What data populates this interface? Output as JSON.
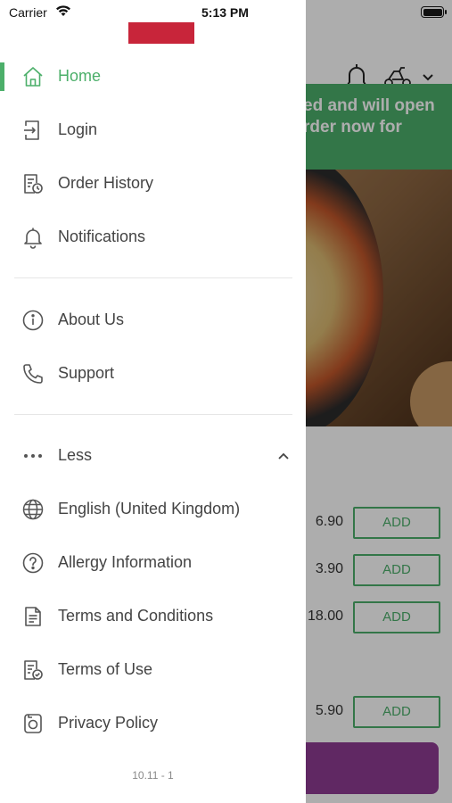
{
  "status_bar": {
    "carrier": "Carrier",
    "time": "5:13 PM"
  },
  "background": {
    "banner_line1": "ed and will open",
    "banner_line2": "rder now for",
    "rows": [
      {
        "price": "6.90",
        "add_label": "ADD"
      },
      {
        "price": "3.90",
        "add_label": "ADD"
      },
      {
        "price": "18.00",
        "add_label": "ADD"
      },
      {
        "price": "5.90",
        "add_label": "ADD"
      }
    ]
  },
  "drawer": {
    "items": [
      {
        "label": "Home",
        "icon": "home-icon",
        "active": true
      },
      {
        "label": "Login",
        "icon": "login-icon"
      },
      {
        "label": "Order History",
        "icon": "order-history-icon"
      },
      {
        "label": "Notifications",
        "icon": "bell-icon"
      },
      {
        "label": "About Us",
        "icon": "info-icon"
      },
      {
        "label": "Support",
        "icon": "phone-icon"
      },
      {
        "label": "Less",
        "icon": "more-dots-icon"
      },
      {
        "label": "English (United Kingdom)",
        "icon": "globe-icon"
      },
      {
        "label": "Allergy Information",
        "icon": "question-circle-icon"
      },
      {
        "label": "Terms and Conditions",
        "icon": "document-icon"
      },
      {
        "label": "Terms of Use",
        "icon": "document-check-icon"
      },
      {
        "label": "Privacy Policy",
        "icon": "privacy-icon"
      }
    ],
    "version": "10.11 - 1"
  },
  "colors": {
    "accent": "#4caf6a",
    "brand": "#c8253a",
    "cart": "#8e3b93"
  }
}
